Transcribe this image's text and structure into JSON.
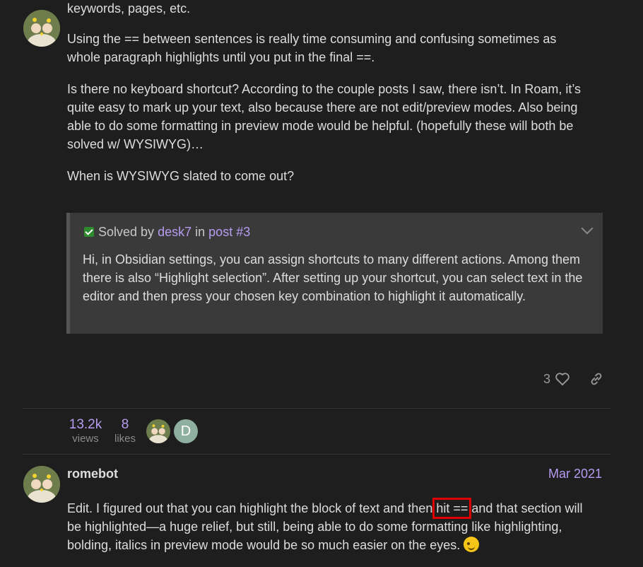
{
  "post1": {
    "top_partial": "keywords, pages, etc.",
    "para1": "Using the == between sentences is really time consuming and confusing sometimes as whole paragraph highlights until you put in the final ==.",
    "para2": "Is there no keyboard shortcut? According to the couple posts I saw, there isn’t. In Roam, it’s quite easy to mark up your text, also because there are not edit/preview modes. Also being able to do some formatting in preview mode would be helpful. (hopefully these will both be solved w/ WYSIWYG)…",
    "para3": "When is WYSIWYG slated to come out?",
    "solved": {
      "prefix": "Solved by",
      "author": "desk7",
      "in_word": "in",
      "post_link": "post #3",
      "text": "Hi, in Obsidian settings, you can assign shortcuts to many different actions. Among them there is also “Highlight selection”. After setting up your shortcut, you can select text in the editor and then press your chosen key combination to highlight it automatically."
    },
    "likes_count": "3"
  },
  "stats": {
    "views_num": "13.2k",
    "views_label": "views",
    "likes_num": "8",
    "likes_label": "likes",
    "participant_initial": "D"
  },
  "post2": {
    "username": "romebot",
    "date": "Mar 2021",
    "text_before": "Edit. I figured out that you can highlight the block of text and then ",
    "text_highlight": "hit ==",
    "text_after": " and that section will be highlighted—a huge relief, but still, being able to do some formatting like highlighting, bolding, italics in preview mode would be so much easier on the eyes."
  },
  "colors": {
    "background": "#1e1e1e",
    "accent": "#b69cf0",
    "solved_box": "#3a3a3a",
    "highlight_outline": "#e00000"
  }
}
